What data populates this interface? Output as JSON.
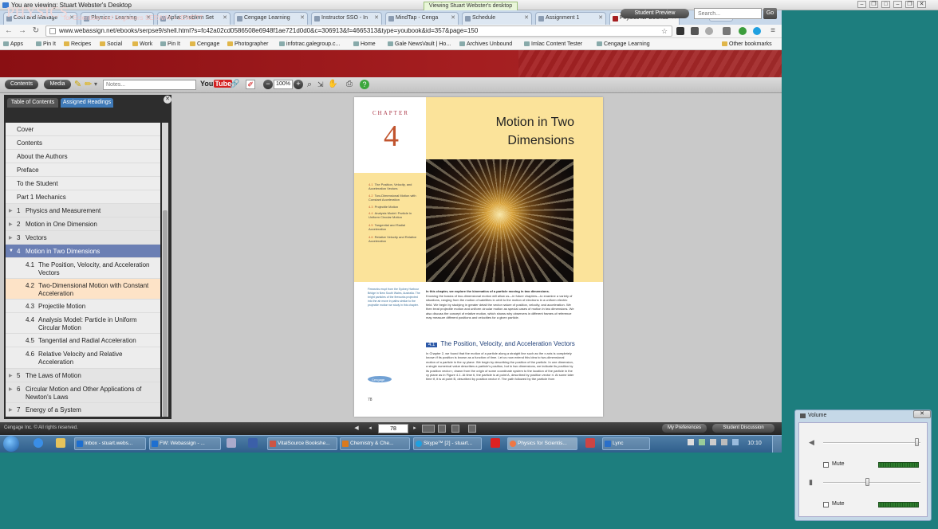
{
  "remote": {
    "title": "You are viewing: Stuart Webster's Desktop",
    "tooltip": "Viewing Stuart Webster's desktop"
  },
  "browser": {
    "tabs": [
      {
        "label": "Cost and Manage"
      },
      {
        "label": "Physics - Learning"
      },
      {
        "label": "Aplia: Problem Set"
      },
      {
        "label": "Cengage Learning"
      },
      {
        "label": "Instructor SSO - In"
      },
      {
        "label": "MindTap - Cenga"
      },
      {
        "label": "Schedule"
      },
      {
        "label": "Assignment 1"
      },
      {
        "label": "Physics for Scientis"
      }
    ],
    "user": "Stuart",
    "url": "www.webassign.net/ebooks/serpse9/shell.html?s=fc42a02cd0586508e6948f1ae721d0d0&c=306913&f=4665313&type=youbook&id=357&page=150",
    "bookmarks": [
      "Apps",
      "Pin It",
      "Recipes",
      "Social",
      "Work",
      "Pin It",
      "Cengage",
      "Photographer",
      "infotrac.galegroup.c...",
      "Home",
      "Gale NewsVault | Ho...",
      "Archives Unbound",
      "Imlac Content Tester",
      "Cengage Learning"
    ],
    "other_bookmarks": "Other bookmarks"
  },
  "webassign": {
    "brand": "PHYSICS",
    "subtitle": "for Scientists and Engineers SERWAY ▪ JEWETT",
    "student_preview": "Student Preview",
    "search_placeholder": "Search...",
    "go": "Go",
    "contents": "Contents",
    "media": "Media",
    "notes_placeholder": "Notes...",
    "youtube_1": "You",
    "youtube_2": "Tube",
    "zoom": "100%"
  },
  "sidebar": {
    "tab_toc": "Table of Contents",
    "tab_assigned": "Assigned Readings",
    "items": [
      {
        "num": "",
        "label": "Cover"
      },
      {
        "num": "",
        "label": "Contents"
      },
      {
        "num": "",
        "label": "About the Authors"
      },
      {
        "num": "",
        "label": "Preface"
      },
      {
        "num": "",
        "label": "To the Student"
      },
      {
        "num": "",
        "label": "Part 1 Mechanics"
      },
      {
        "num": "1",
        "label": "Physics and Measurement"
      },
      {
        "num": "2",
        "label": "Motion in One Dimension"
      },
      {
        "num": "3",
        "label": "Vectors"
      },
      {
        "num": "4",
        "label": "Motion in Two Dimensions"
      },
      {
        "num": "4.1",
        "label": "The Position, Velocity, and Acceleration Vectors"
      },
      {
        "num": "4.2",
        "label": "Two-Dimensional Motion with Constant Acceleration"
      },
      {
        "num": "4.3",
        "label": "Projectile Motion"
      },
      {
        "num": "4.4",
        "label": "Analysis Model: Particle in Uniform Circular Motion"
      },
      {
        "num": "4.5",
        "label": "Tangential and Radial Acceleration"
      },
      {
        "num": "4.6",
        "label": "Relative Velocity and Relative Acceleration"
      },
      {
        "num": "5",
        "label": "The Laws of Motion"
      },
      {
        "num": "6",
        "label": "Circular Motion and Other Applications of Newton's Laws"
      },
      {
        "num": "7",
        "label": "Energy of a System"
      }
    ]
  },
  "page": {
    "chapter_word": "CHAPTER",
    "chapter_num": "4",
    "title_1": "Motion in Two",
    "title_2": "Dimensions",
    "sections": [
      {
        "num": "4.1",
        "label": "The Position, Velocity, and Acceleration Vectors"
      },
      {
        "num": "4.2",
        "label": "Two-Dimensional Motion with Constant Acceleration"
      },
      {
        "num": "4.3",
        "label": "Projectile Motion"
      },
      {
        "num": "4.4",
        "label": "Analysis Model: Particle in Uniform Circular Motion"
      },
      {
        "num": "4.5",
        "label": "Tangential and Radial Acceleration"
      },
      {
        "num": "4.6",
        "label": "Relative Velocity and Relative Acceleration"
      }
    ],
    "intro_bold": "In this chapter, we explore the kinematics of a particle moving in two dimensions.",
    "intro_text": "Knowing the basics of two-dimensional motion will allow us—in future chapters—to examine a variety of situations, ranging from the motion of satellites in orbit to the motion of electrons in a uniform electric field. We begin by studying in greater detail the vector nature of position, velocity, and acceleration. We then treat projectile motion and uniform circular motion as special cases of motion in two dimensions. We also discuss the concept of relative motion, which shows why observers in different frames of reference may measure different positions and velocities for a given particle.",
    "section_num": "4.1",
    "section_title": "The Position, Velocity, and Acceleration Vectors",
    "section_text": "In Chapter 2, we found that the motion of a particle along a straight line such as the x axis is completely known if its position is known as a function of time. Let us now extend this idea to two-dimensional motion of a particle in the xy plane. We begin by describing the position of the particle. In one dimension, a single numerical value describes a particle's position, but in two dimensions, we indicate its position by its position vector r, drawn from the origin of some coordinate system to the location of the particle in the xy plane as in Figure 4.1. At time ti, the particle is at point A, described by position vector ri. At some later time tf, it is at point B, described by position vector rf. The path followed by the particle from",
    "caption": "Fireworks erupt from the Sydney Harbour Bridge in New South Wales, Australia. The bright particles of the fireworks projected into the air move in paths similar to the projectile motion we study in this chapter.",
    "logo_text": "Cengage",
    "page_number": "78"
  },
  "footer": {
    "copyright": "Cengage Inc. © All rights reserved.",
    "page": "78",
    "my_preferences": "My Preferences",
    "student_discussion": "Student Discussion"
  },
  "taskbar": {
    "items": [
      "Inbox - stuart.webs...",
      "FW: Webassign - ...",
      "VitalSource Bookshe...",
      "Chemistry & Che...",
      "Skype™ [2] - stuart...",
      "Physics for Scientis...",
      "Lync"
    ],
    "clock": "10:10"
  },
  "volume": {
    "title": "Volume",
    "mute_1": "Mute",
    "mute_2": "Mute",
    "level_1": 0.98,
    "level_2": 0.45
  },
  "colors": {
    "brand_red": "#a51e20",
    "selected_toc": "#6b7fb4",
    "highlight_toc": "#fde3c7",
    "accent_orange": "#c1542e"
  }
}
